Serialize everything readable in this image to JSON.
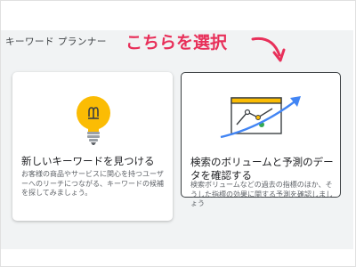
{
  "header": {
    "title": "キーワード プランナー",
    "callout": "こちらを選択"
  },
  "cards": [
    {
      "title": "新しいキーワードを見つける",
      "description": "お客様の商品やサービスに関心を持つユーザーへのリーチにつながる、キーワードの候補を探してみましょう。",
      "icon": "lightbulb-icon"
    },
    {
      "title": "検索のボリュームと予測のデータを確認する",
      "description": "検索ボリュームなどの過去の指標のほか、そうした指標の効果に関する予測を確認しましょう",
      "icon": "chart-trend-icon"
    }
  ],
  "colors": {
    "callout": "#e8305a",
    "bulb": "#fbbc04",
    "accent_blue": "#4285f4",
    "accent_green": "#34a853"
  }
}
